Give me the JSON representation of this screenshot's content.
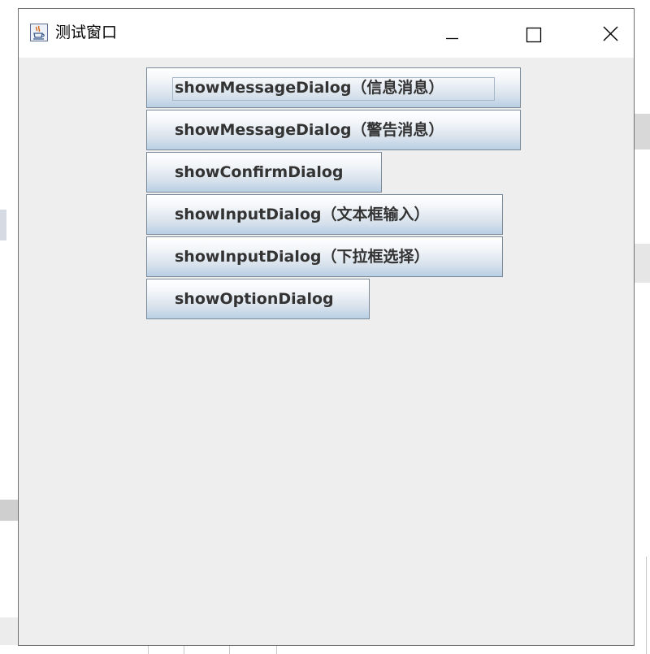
{
  "window": {
    "title": "测试窗口",
    "icon": "java-cup-icon",
    "controls": {
      "minimize": "minimize-icon",
      "maximize": "maximize-icon",
      "close": "close-icon"
    }
  },
  "buttons": [
    {
      "label": "showMessageDialog（信息消息）",
      "focused": true
    },
    {
      "label": "showMessageDialog（警告消息）",
      "focused": false
    },
    {
      "label": "showConfirmDialog",
      "focused": false
    },
    {
      "label": "showInputDialog（文本框输入）",
      "focused": false
    },
    {
      "label": "showInputDialog（下拉框选择）",
      "focused": false
    },
    {
      "label": "showOptionDialog",
      "focused": false
    }
  ],
  "colors": {
    "title_bar": "#ffffff",
    "client_bg": "#eeeeee",
    "button_border": "#7a8a99",
    "button_gradient_bottom": "#b8cfe5",
    "button_text": "#333333"
  }
}
